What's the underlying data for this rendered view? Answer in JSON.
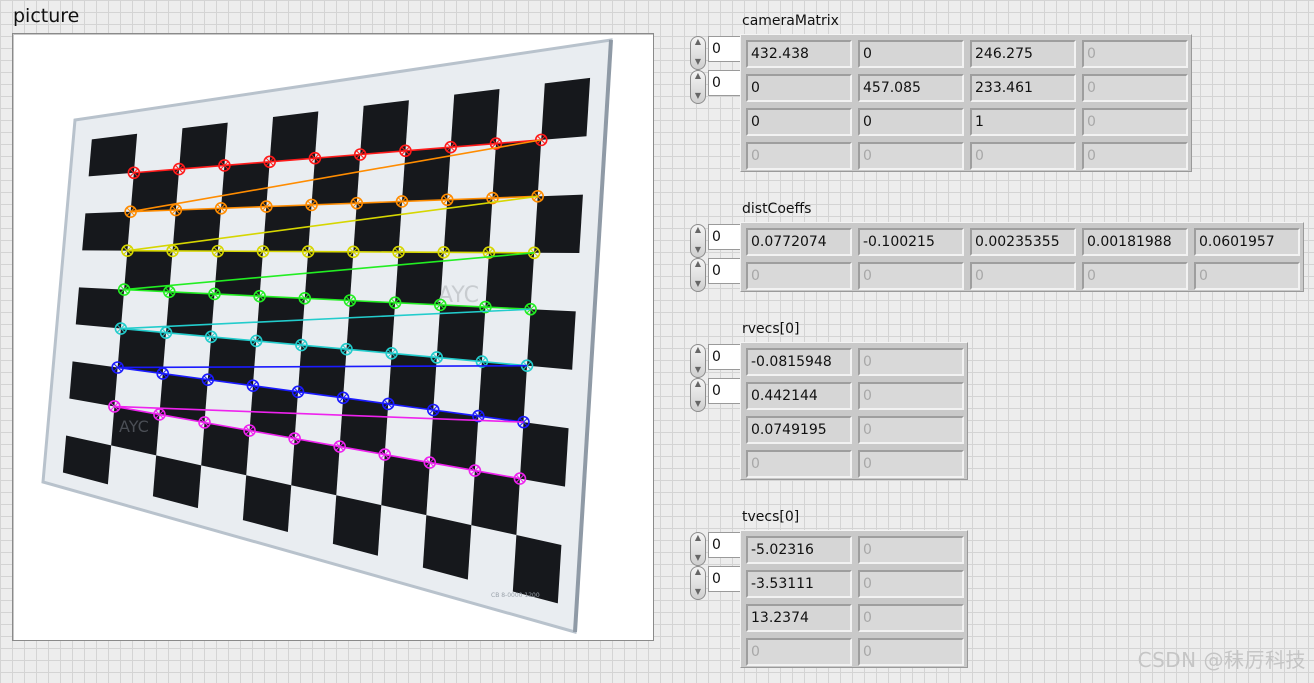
{
  "picture": {
    "label": "picture",
    "board_watermark": "AYC",
    "board_footer": "CB 8-0000 1200"
  },
  "camera_matrix": {
    "label": "cameraMatrix",
    "index_row": "0",
    "index_col": "0",
    "rows": [
      [
        "432.438",
        "0",
        "246.275",
        "0"
      ],
      [
        "0",
        "457.085",
        "233.461",
        "0"
      ],
      [
        "0",
        "0",
        "1",
        "0"
      ],
      [
        "0",
        "0",
        "0",
        "0"
      ]
    ]
  },
  "dist_coeffs": {
    "label": "distCoeffs",
    "index_row": "0",
    "index_col": "0",
    "rows": [
      [
        "0.0772074",
        "-0.100215",
        "0.00235355",
        "0.00181988",
        "0.0601957"
      ],
      [
        "0",
        "0",
        "0",
        "0",
        "0"
      ]
    ]
  },
  "rvecs": {
    "label": "rvecs[0]",
    "index_row": "0",
    "index_col": "0",
    "rows": [
      [
        "-0.0815948",
        "0"
      ],
      [
        "0.442144",
        "0"
      ],
      [
        "0.0749195",
        "0"
      ],
      [
        "0",
        "0"
      ]
    ]
  },
  "tvecs": {
    "label": "tvecs[0]",
    "index_row": "0",
    "index_col": "0",
    "rows": [
      [
        "-5.02316",
        "0"
      ],
      [
        "-3.53111",
        "0"
      ],
      [
        "13.2374",
        "0"
      ],
      [
        "0",
        "0"
      ]
    ]
  },
  "colors": {
    "corner_rows": [
      "#ff1a1a",
      "#ff8c00",
      "#d6d600",
      "#22ee22",
      "#22cccc",
      "#1a1aff",
      "#ee22ee"
    ]
  },
  "footer": {
    "watermark": "CSDN @秣厉科技"
  }
}
